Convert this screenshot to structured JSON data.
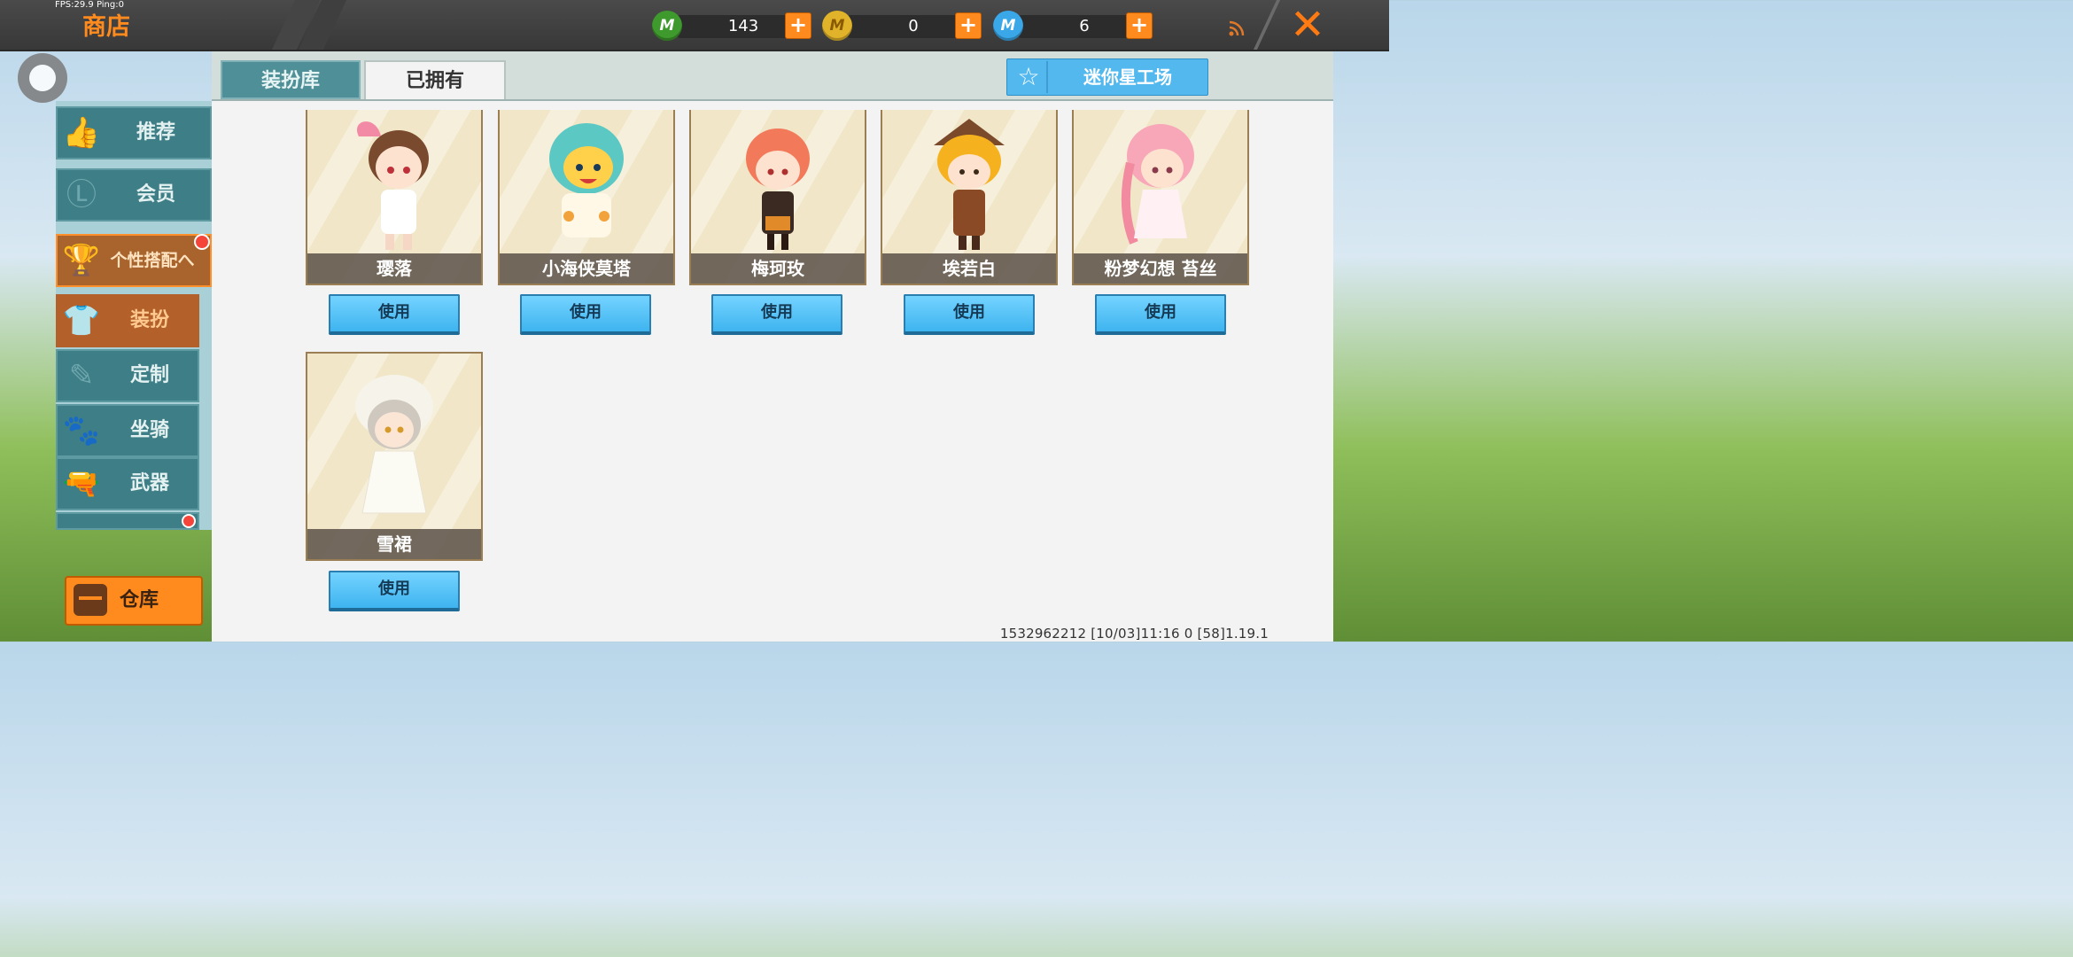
{
  "debug": {
    "fps_text": "FPS:29.9  Ping:0"
  },
  "header": {
    "title": "商店"
  },
  "currencies": [
    {
      "icon": "mini-bean-icon",
      "color": "#3f9a2e",
      "value": "143"
    },
    {
      "icon": "mini-coin-icon",
      "color": "#e0b32a",
      "value": "0"
    },
    {
      "icon": "mini-point-icon",
      "color": "#3aa7e8",
      "value": "6"
    }
  ],
  "sidebar": {
    "items": [
      {
        "label": "推荐",
        "icon": "thumbs-up-icon"
      },
      {
        "label": "会员",
        "icon": "member-icon"
      },
      {
        "label": "个性搭配へ",
        "icon": "trophy-icon"
      },
      {
        "label": "装扮",
        "icon": "shirt-icon"
      },
      {
        "label": "定制",
        "icon": "pencil-icon"
      },
      {
        "label": "坐骑",
        "icon": "mount-icon"
      },
      {
        "label": "武器",
        "icon": "pistol-icon"
      }
    ],
    "warehouse_label": "仓库"
  },
  "tabs": [
    {
      "label": "装扮库"
    },
    {
      "label": "已拥有"
    }
  ],
  "workshop_label": "迷你星工场",
  "skins": [
    {
      "name": "璎落",
      "button": "使用"
    },
    {
      "name": "小海侠莫塔",
      "button": "使用"
    },
    {
      "name": "梅珂玫",
      "button": "使用"
    },
    {
      "name": "埃若白",
      "button": "使用"
    },
    {
      "name": "粉梦幻想 苔丝",
      "button": "使用"
    },
    {
      "name": "雪裙",
      "button": "使用"
    }
  ],
  "footer": {
    "text": "1532962212   [10/03]11:16 0    [58]1.19.1"
  }
}
